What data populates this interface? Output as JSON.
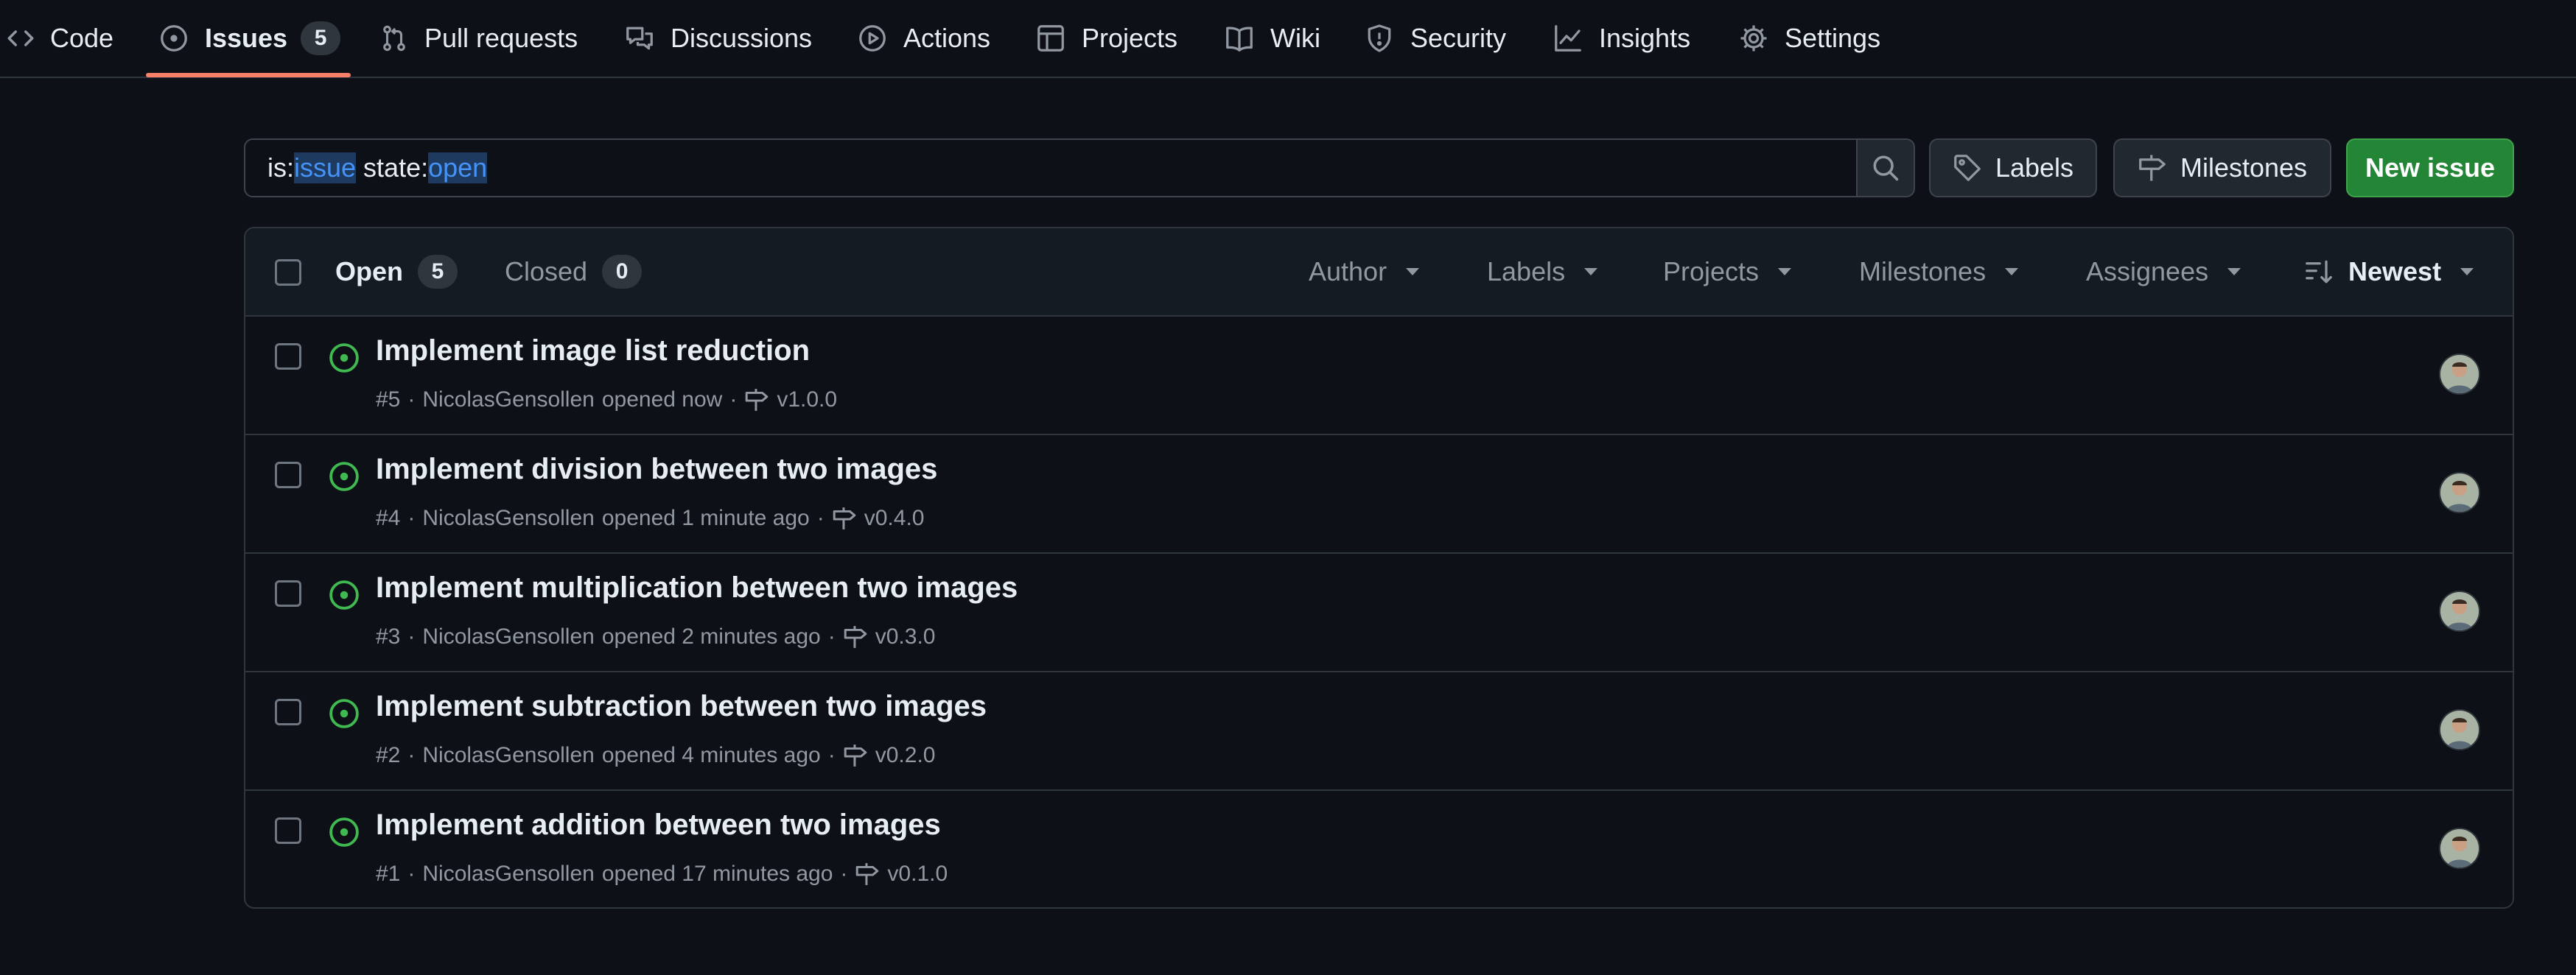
{
  "nav": {
    "items": [
      {
        "label": "Code",
        "icon": "code-icon"
      },
      {
        "label": "Issues",
        "icon": "issue-opened-icon",
        "count": "5",
        "active": true
      },
      {
        "label": "Pull requests",
        "icon": "git-pull-request-icon"
      },
      {
        "label": "Discussions",
        "icon": "comment-discussion-icon"
      },
      {
        "label": "Actions",
        "icon": "play-icon"
      },
      {
        "label": "Projects",
        "icon": "table-icon"
      },
      {
        "label": "Wiki",
        "icon": "book-icon"
      },
      {
        "label": "Security",
        "icon": "shield-icon"
      },
      {
        "label": "Insights",
        "icon": "graph-icon"
      },
      {
        "label": "Settings",
        "icon": "gear-icon"
      }
    ]
  },
  "search": {
    "prefix1": "is:",
    "value1": "issue",
    "prefix2": " state:",
    "value2": "open"
  },
  "toolbar": {
    "labels_label": "Labels",
    "milestones_label": "Milestones",
    "new_issue_label": "New issue"
  },
  "list_header": {
    "open_label": "Open",
    "open_count": "5",
    "closed_label": "Closed",
    "closed_count": "0",
    "filters": [
      "Author",
      "Labels",
      "Projects",
      "Milestones",
      "Assignees"
    ],
    "sort_label": "Newest"
  },
  "issues": [
    {
      "title": "Implement image list reduction",
      "number": "#5",
      "author": "NicolasGensollen",
      "opened": "opened now",
      "milestone": "v1.0.0"
    },
    {
      "title": "Implement division between two images",
      "number": "#4",
      "author": "NicolasGensollen",
      "opened": "opened 1 minute ago",
      "milestone": "v0.4.0"
    },
    {
      "title": "Implement multiplication between two images",
      "number": "#3",
      "author": "NicolasGensollen",
      "opened": "opened 2 minutes ago",
      "milestone": "v0.3.0"
    },
    {
      "title": "Implement subtraction between two images",
      "number": "#2",
      "author": "NicolasGensollen",
      "opened": "opened 4 minutes ago",
      "milestone": "v0.2.0"
    },
    {
      "title": "Implement addition between two images",
      "number": "#1",
      "author": "NicolasGensollen",
      "opened": "opened 17 minutes ago",
      "milestone": "v0.1.0"
    }
  ],
  "colors": {
    "background": "#0d1117",
    "accent_underline": "#f78166",
    "open_status": "#3fb950",
    "primary_button": "#238636",
    "search_highlight": "#4493f8"
  }
}
